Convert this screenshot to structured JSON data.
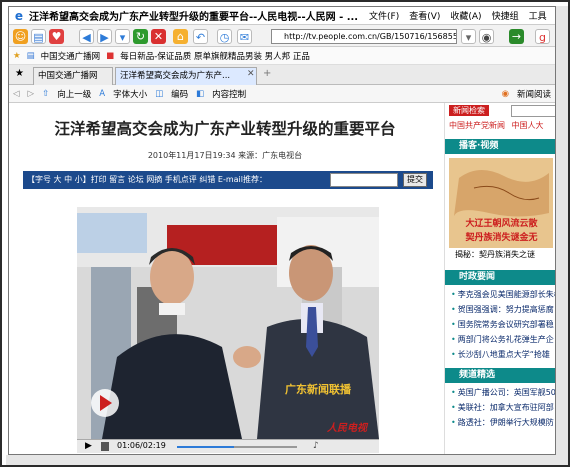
{
  "window": {
    "title": "汪洋希望高交会成为广东产业转型升级的重要平台--人民电视--人民网 - ...",
    "menu": [
      "文件(F)",
      "查看(V)",
      "收藏(A)",
      "快捷组",
      "工具"
    ]
  },
  "toolbar": {
    "address": "http://tv.people.com.cn/GB/150716/156855/1"
  },
  "favorites": {
    "items": [
      "中国交通广播网",
      "每日新品-保证品质 原单旗舰精品男装 男人邦 正品"
    ]
  },
  "tabs": [
    {
      "label": "中国交通广播网"
    },
    {
      "label": "汪洋希望高交会成为广东产..."
    }
  ],
  "navbar": {
    "up": "向上一级",
    "font": "字体大小",
    "encoding": "编码",
    "control": "内容控制",
    "rss": "新闻阅读"
  },
  "article": {
    "headline": "汪洋希望高交会成为广东产业转型升级的重要平台",
    "dateline": "2010年11月17日19:34  来源：广东电视台",
    "tools": "【字号 大 中 小】打印 留言 论坛 网摘 手机点评 纠错   E-mail推荐：",
    "submit": "提交",
    "video_time": "01:06/02:19",
    "video_caption": "广东新闻联播",
    "video_logo": "人民电视"
  },
  "sidebar": {
    "search_tab": "新闻检索",
    "search_links": [
      "中国共产党新闻",
      "中国人大"
    ],
    "broadcast_title": "播客·视频",
    "video_banner_1": "大辽王朝风流云散",
    "video_banner_2": "契丹族消失谜金无",
    "video_caption": "揭秘：契丹族消失之谜",
    "news_title": "时政要闻",
    "news": [
      "李克强会见美国能源部长朱棣",
      "贺国强强调：努力提高惩腐",
      "国务院常务会议研究部署稳",
      "两部门将公务礼花弹生产企",
      "长沙刮八地重点大学“抢雄"
    ],
    "channel_title": "频道精选",
    "channels": [
      "英国广播公司：英国军舰50",
      "美联社：加拿大宣布驻阿部",
      "路透社：伊朗举行大规模防"
    ]
  },
  "colors": {
    "accent": "#0d8a8a",
    "navy": "#1c4a8c",
    "red": "#cc1f1f"
  }
}
